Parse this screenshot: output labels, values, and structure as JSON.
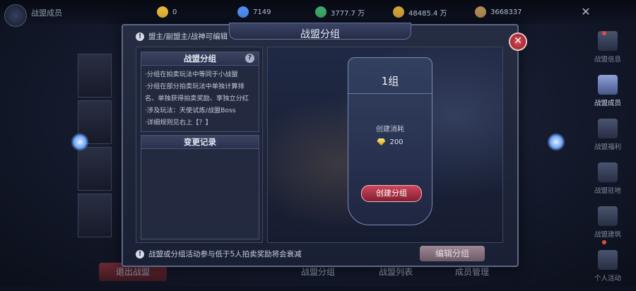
{
  "topbar": {
    "title": "战盟成员",
    "resources": [
      {
        "icon": "gold-gem-icon",
        "value": "0",
        "color": "#e6b83a"
      },
      {
        "icon": "blue-diamond-icon",
        "value": "7149",
        "color": "#4f8ff0"
      },
      {
        "icon": "green-crystal-icon",
        "value": "3777.7 万",
        "color": "#3fa86a"
      },
      {
        "icon": "gold-coin-icon",
        "value": "48485.4 万",
        "color": "#d2a23a"
      },
      {
        "icon": "bag-icon",
        "value": "3668337",
        "color": "#b38a54"
      }
    ]
  },
  "sidebar": {
    "items": [
      {
        "label": "战盟信息",
        "icon": "flag-icon"
      },
      {
        "label": "战盟成员",
        "icon": "members-icon"
      },
      {
        "label": "战盟福利",
        "icon": "gift-icon"
      },
      {
        "label": "战盟驻地",
        "icon": "shield-icon"
      },
      {
        "label": "战盟建筑",
        "icon": "crossed-swords-icon"
      },
      {
        "label": "个人活动",
        "icon": "activity-icon"
      }
    ]
  },
  "background_buttons": {
    "quit": "退出战盟",
    "group": "战盟分组",
    "list": "战盟列表",
    "manage": "成员管理"
  },
  "dialog": {
    "title": "战盟分组",
    "header_note": "盟主/副盟主/战神可编辑",
    "rules_title": "战盟分组",
    "rules": [
      "·分组在拍卖玩法中等同于小战盟",
      "·分组在部分拍卖玩法中单独计算排",
      "名、单独获得拍卖奖励、享独立分红",
      "·涉及玩法：天使试炼/战盟Boss",
      "·详细规则见右上【？】"
    ],
    "log_title": "变更记录",
    "group_card": {
      "name": "1组",
      "cost_label": "创建消耗",
      "cost_value": "200",
      "create_button": "创建分组"
    },
    "footer_note": "战盟或分组活动参与低于5人拍卖奖励将会衰减",
    "edit_button": "编辑分组"
  }
}
